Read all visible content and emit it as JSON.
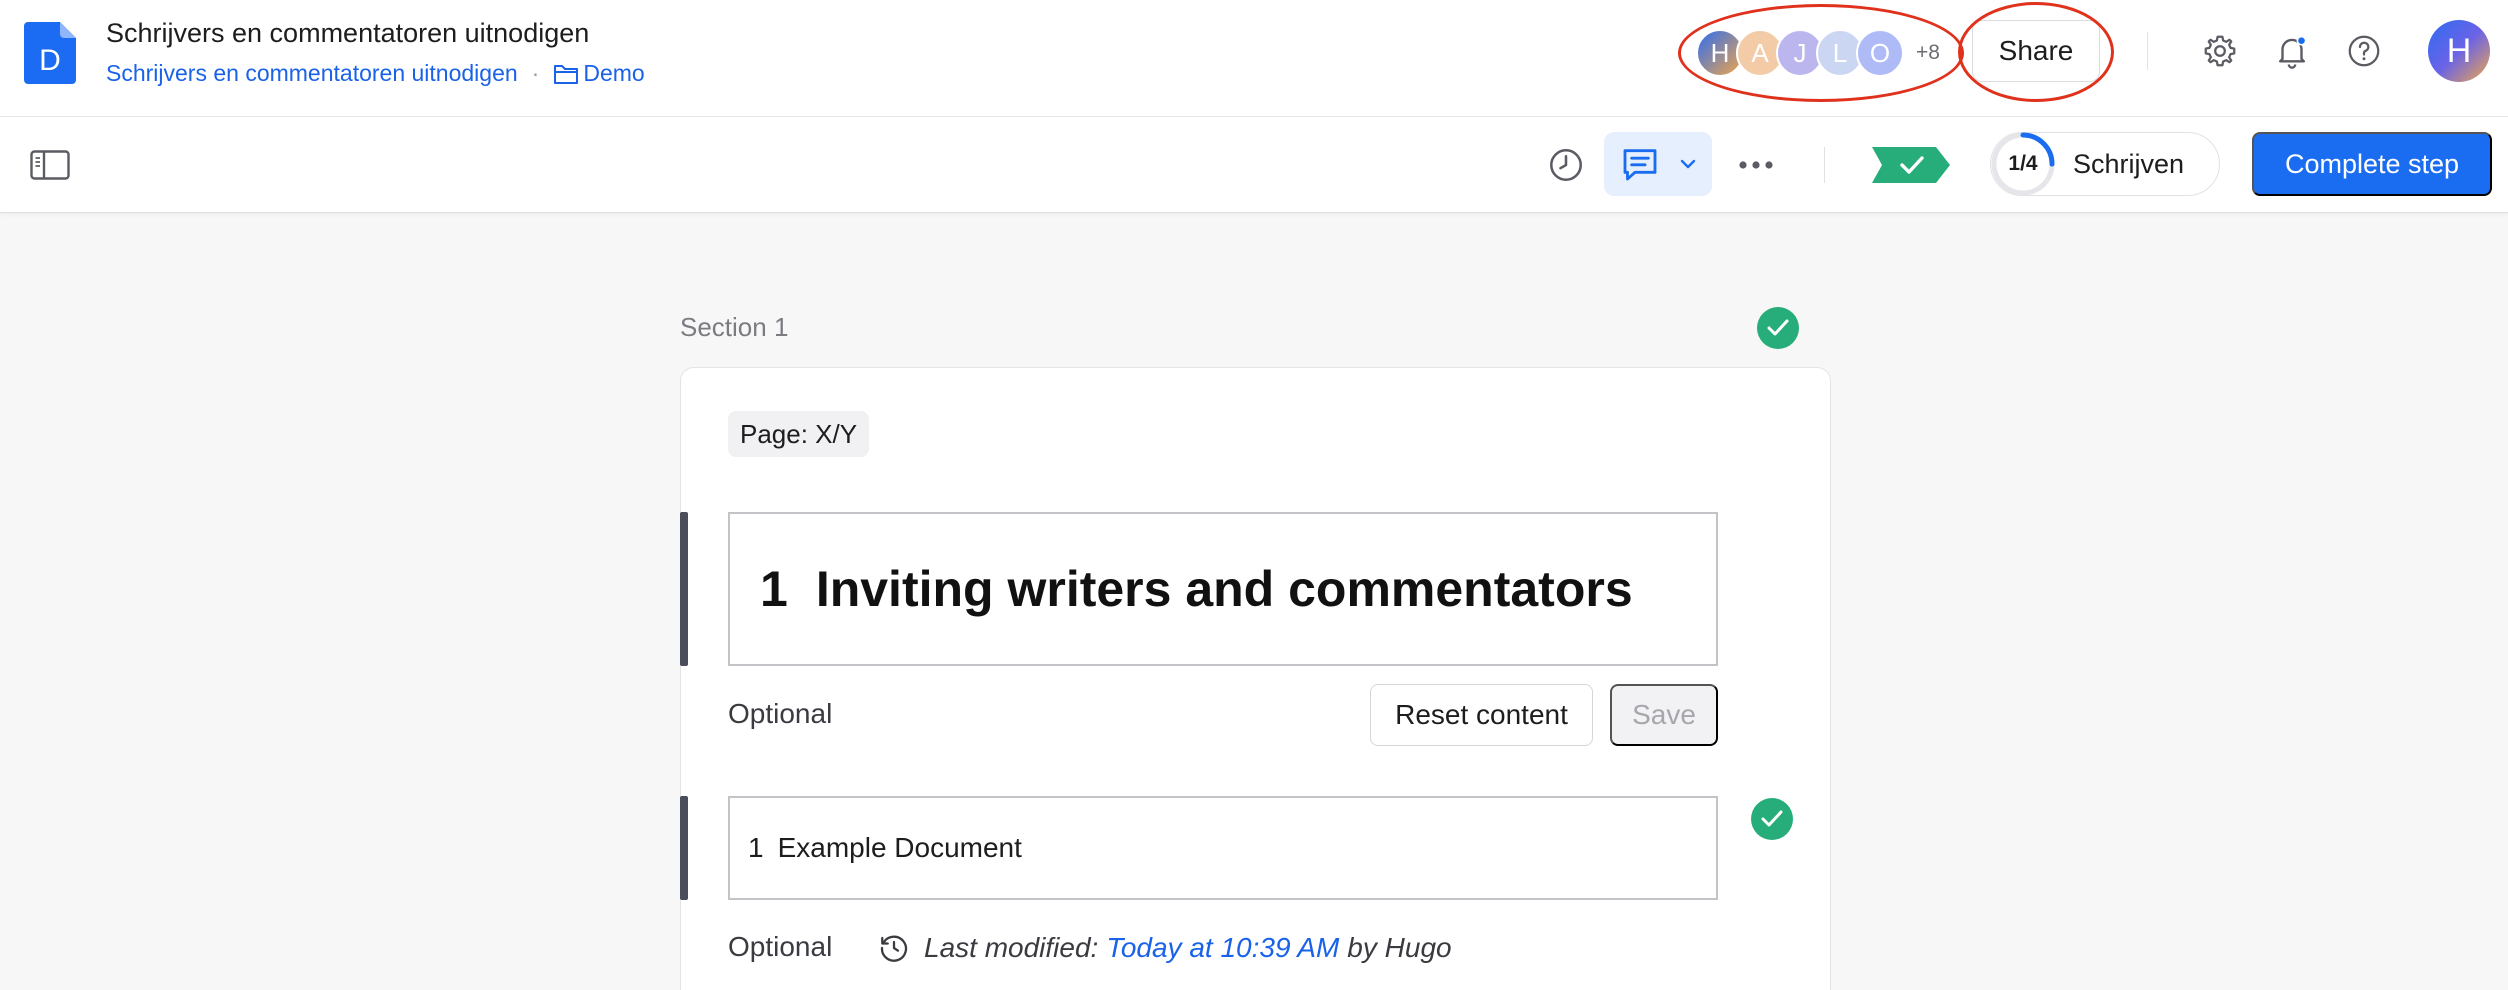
{
  "header": {
    "logo_letter": "D",
    "title": "Schrijvers en commentatoren uitnodigen",
    "breadcrumb": {
      "document": "Schrijvers en commentatoren uitnodigen",
      "separator": "·",
      "folder": "Demo"
    },
    "collaborators": [
      {
        "initial": "H",
        "color": "#3d6cf0"
      },
      {
        "initial": "A",
        "color": "#f3c9a4"
      },
      {
        "initial": "J",
        "color": "#b6b2ee"
      },
      {
        "initial": "L",
        "color": "#c9d4f2"
      },
      {
        "initial": "O",
        "color": "#aab7f5"
      }
    ],
    "collaborators_more": "+8",
    "share_label": "Share",
    "user_initial": "H"
  },
  "toolbar": {
    "progress_text": "1/4",
    "progress_fraction": 0.25,
    "step_label": "Schrijven",
    "complete_label": "Complete step"
  },
  "content": {
    "section_label": "Section 1",
    "page_chip": "Page: X/Y",
    "heading": {
      "number": "1",
      "text": "Inviting writers and commentators"
    },
    "heading_optional": "Optional",
    "reset_label": "Reset content",
    "save_label": "Save",
    "doc_item": {
      "number": "1",
      "text": "Example Document"
    },
    "doc_optional": "Optional",
    "modified": {
      "prefix": "Last modified:",
      "when": "Today at 10:39 AM",
      "by": "by Hugo"
    }
  },
  "colors": {
    "accent": "#1a6cf0",
    "success": "#27ad7a",
    "annotation": "#e0311c"
  }
}
